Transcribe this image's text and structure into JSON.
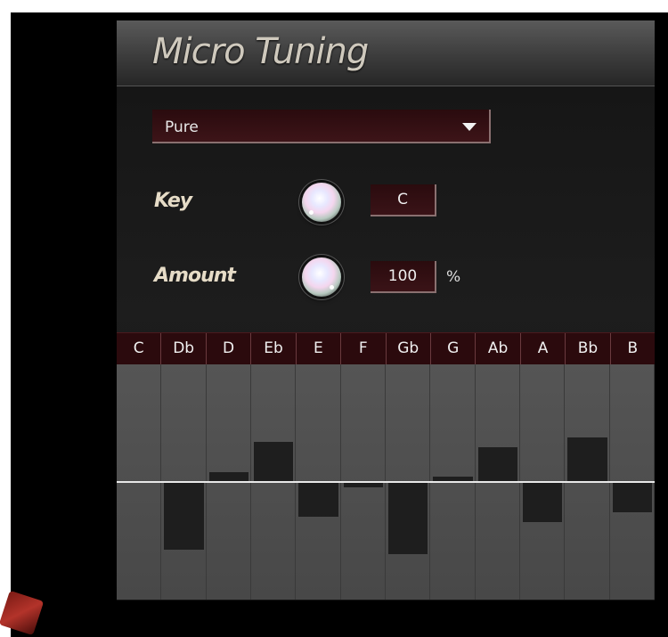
{
  "title": "Micro Tuning",
  "preset": {
    "value": "Pure"
  },
  "key": {
    "label": "Key",
    "value": "C"
  },
  "amount": {
    "label": "Amount",
    "value": "100",
    "unit": "%"
  },
  "notes": [
    "C",
    "Db",
    "D",
    "Eb",
    "E",
    "F",
    "Gb",
    "G",
    "Ab",
    "A",
    "Bb",
    "B"
  ],
  "tuning_offsets": [
    0,
    -27,
    4,
    16,
    -14,
    -2,
    -29,
    2,
    14,
    -16,
    18,
    -12
  ],
  "colors": {
    "note_bar": "#2b0a0d",
    "value_box": "#2a0b0e",
    "grid_bg": "#4a4a4a",
    "title_text": "#cfc9bd"
  }
}
